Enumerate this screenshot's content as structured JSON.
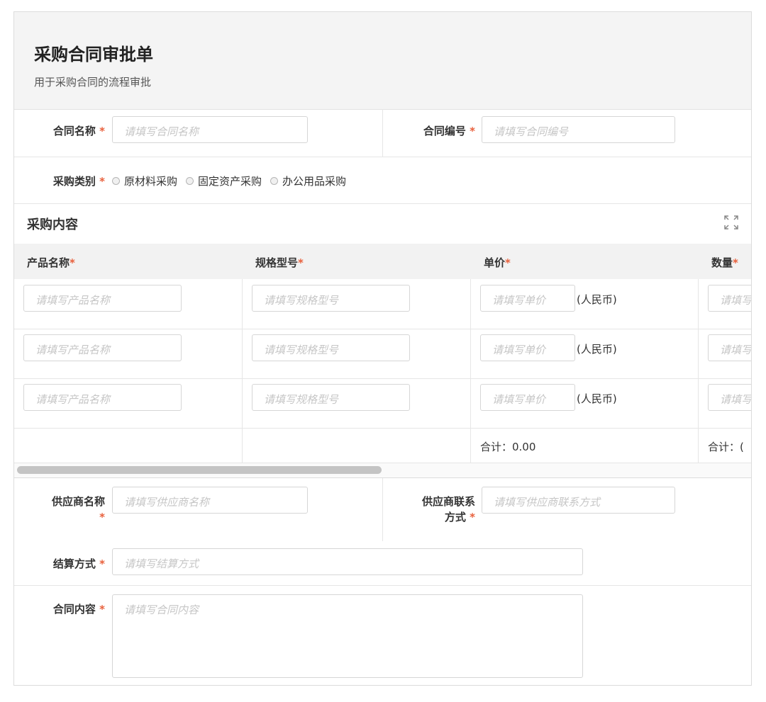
{
  "form": {
    "title": "采购合同审批单",
    "subtitle": "用于采购合同的流程审批",
    "required_mark": "*",
    "fields": {
      "contract_name": {
        "label": "合同名称",
        "placeholder": "请填写合同名称"
      },
      "contract_no": {
        "label": "合同编号",
        "placeholder": "请填写合同编号"
      },
      "purchase_type": {
        "label": "采购类别",
        "options": [
          "原材料采购",
          "固定资产采购",
          "办公用品采购"
        ]
      },
      "supplier_name": {
        "label_line1": "供应商名称",
        "placeholder": "请填写供应商名称"
      },
      "supplier_contact": {
        "label_line1": "供应商联系",
        "label_line2": "方式",
        "placeholder": "请填写供应商联系方式"
      },
      "settlement": {
        "label": "结算方式",
        "placeholder": "请填写结算方式"
      },
      "contract_content": {
        "label": "合同内容",
        "placeholder": "请填写合同内容"
      }
    }
  },
  "table": {
    "section_title": "采购内容",
    "expand_icon": "expand-icon",
    "columns": [
      "产品名称",
      "规格型号",
      "单价",
      "数量"
    ],
    "placeholders": {
      "product": "请填写产品名称",
      "spec": "请填写规格型号",
      "price": "请填写单价",
      "qty": "请填写"
    },
    "currency_suffix": "(人民币)",
    "rows": 3,
    "totals": {
      "price": "合计：0.00",
      "qty": "合计：("
    }
  }
}
